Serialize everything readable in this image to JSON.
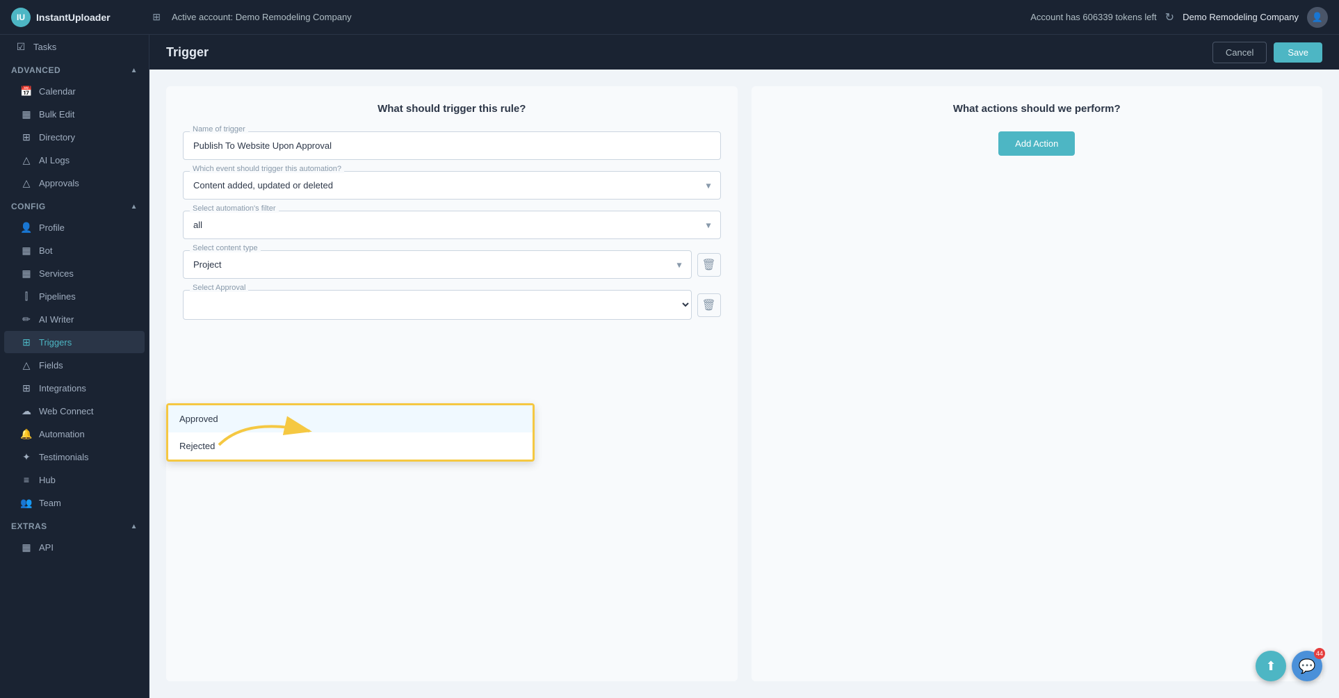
{
  "header": {
    "logo_text": "InstantUploader",
    "pin_icon": "⊞",
    "active_account_label": "Active account: Demo Remodeling Company",
    "tokens_label": "Account has 606339 tokens left",
    "company_name": "Demo Remodeling Company"
  },
  "sidebar": {
    "top_items": [
      {
        "id": "tasks",
        "label": "Tasks",
        "icon": "☑"
      }
    ],
    "sections": [
      {
        "id": "advanced",
        "label": "Advanced",
        "collapsed": false,
        "items": [
          {
            "id": "calendar",
            "label": "Calendar",
            "icon": "📅"
          },
          {
            "id": "bulk-edit",
            "label": "Bulk Edit",
            "icon": "▦"
          },
          {
            "id": "directory",
            "label": "Directory",
            "icon": "⊞"
          },
          {
            "id": "ai-logs",
            "label": "AI Logs",
            "icon": "△"
          },
          {
            "id": "approvals",
            "label": "Approvals",
            "icon": "△"
          }
        ]
      },
      {
        "id": "config",
        "label": "Config",
        "collapsed": false,
        "items": [
          {
            "id": "profile",
            "label": "Profile",
            "icon": "👤"
          },
          {
            "id": "bot",
            "label": "Bot",
            "icon": "▦"
          },
          {
            "id": "services",
            "label": "Services",
            "icon": "▦"
          },
          {
            "id": "pipelines",
            "label": "Pipelines",
            "icon": "⫿"
          },
          {
            "id": "ai-writer",
            "label": "AI Writer",
            "icon": "✏"
          },
          {
            "id": "triggers",
            "label": "Triggers",
            "icon": "⊞"
          },
          {
            "id": "fields",
            "label": "Fields",
            "icon": "△"
          },
          {
            "id": "integrations",
            "label": "Integrations",
            "icon": "⊞"
          },
          {
            "id": "web-connect",
            "label": "Web Connect",
            "icon": "☁"
          },
          {
            "id": "automation",
            "label": "Automation",
            "icon": "🔔"
          },
          {
            "id": "testimonials",
            "label": "Testimonials",
            "icon": "✦"
          },
          {
            "id": "hub",
            "label": "Hub",
            "icon": "≡"
          },
          {
            "id": "team",
            "label": "Team",
            "icon": "👥"
          }
        ]
      },
      {
        "id": "extras",
        "label": "Extras",
        "collapsed": false,
        "items": [
          {
            "id": "api",
            "label": "API",
            "icon": "▦"
          }
        ]
      }
    ]
  },
  "subheader": {
    "title": "Trigger",
    "cancel_label": "Cancel",
    "save_label": "Save"
  },
  "trigger_form": {
    "left_panel_title": "What should trigger this rule?",
    "right_panel_title": "What actions should we perform?",
    "add_action_label": "Add Action",
    "name_label": "Name of trigger",
    "name_value": "Publish To Website Upon Approval",
    "event_label": "Which event should trigger this automation?",
    "event_value": "Content added, updated or deleted",
    "filter_label": "Select automation's filter",
    "filter_value": "all",
    "content_type_label": "Select content type",
    "content_type_value": "Project",
    "approval_label": "Select Approval",
    "approval_value": "",
    "dropdown_options": [
      {
        "id": "approved",
        "label": "Approved",
        "highlighted": true
      },
      {
        "id": "rejected",
        "label": "Rejected",
        "highlighted": false
      }
    ]
  },
  "floating": {
    "chat_icon": "💬",
    "up_icon": "⬆",
    "badge_count": "44"
  }
}
